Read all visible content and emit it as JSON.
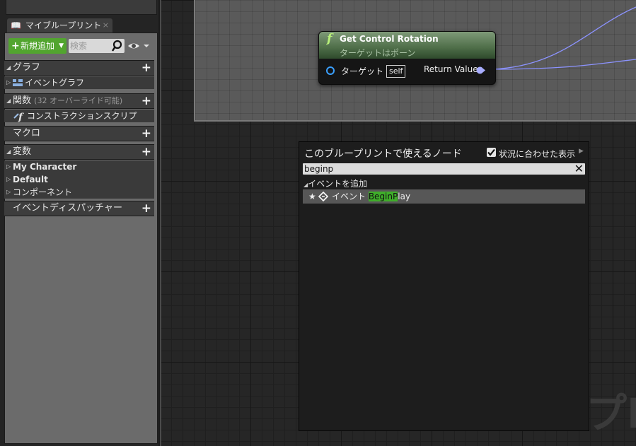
{
  "left_panel": {
    "tab_title": "マイブループリント",
    "tab_close": "×",
    "toolbar": {
      "add_new_label": "新規追加",
      "search_placeholder": "検索"
    },
    "sections": {
      "graphs": {
        "label": "グラフ",
        "items": [
          {
            "label": "イベントグラフ",
            "icon": "event-graph-icon"
          }
        ]
      },
      "functions": {
        "label": "関数",
        "sublabel": "(32 オーバーライド可能)",
        "items": [
          {
            "label": "コンストラクションスクリプ",
            "icon": "function-icon"
          }
        ]
      },
      "macros": {
        "label": "マクロ"
      },
      "variables": {
        "label": "変数",
        "items": [
          {
            "label": "My Character"
          },
          {
            "label": "Default"
          },
          {
            "label": "コンポーネント"
          }
        ]
      },
      "dispatchers": {
        "label": "イベントディスパッチャー"
      }
    }
  },
  "node": {
    "title": "Get Control Rotation",
    "subtitle": "ターゲットはポーン",
    "input_pin_label": "ターゲット",
    "input_pin_default": "self",
    "output_pin_label": "Return Value",
    "header_color": "#4e6d48",
    "pin_color": "#3aa0ff",
    "wire_color": "#8c93ff"
  },
  "action_menu": {
    "title": "このブループリントで使えるノード",
    "context_sensitive_label": "状況に合わせた表示",
    "context_sensitive_checked": true,
    "search_value": "beginp",
    "category_label": "イベントを追加",
    "result": {
      "prefix": "イベント ",
      "match": "BeginP",
      "suffix": "lay"
    },
    "highlight_color": "#3fae2a"
  },
  "watermark_text": "プI"
}
